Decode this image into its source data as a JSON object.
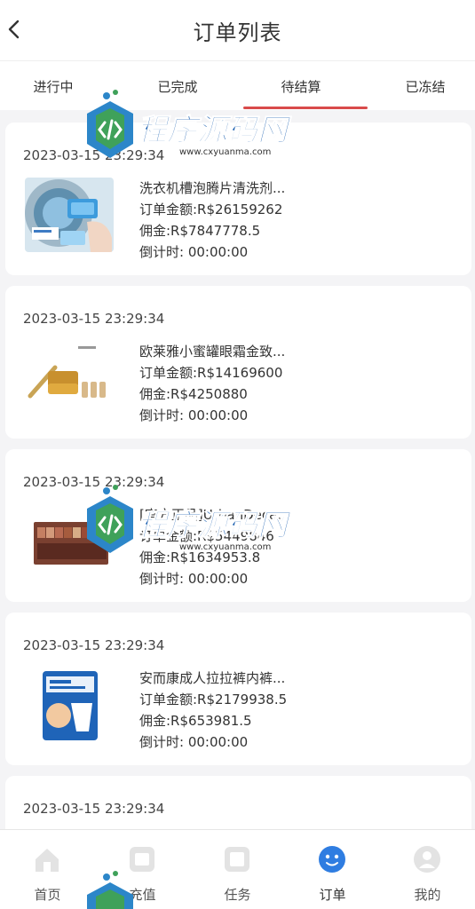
{
  "header": {
    "title": "订单列表"
  },
  "tabs": [
    {
      "label": "进行中",
      "active": false
    },
    {
      "label": "已完成",
      "active": false
    },
    {
      "label": "待结算",
      "active": true
    },
    {
      "label": "已冻结",
      "active": false
    }
  ],
  "orders": [
    {
      "time": "2023-03-15 23:29:34",
      "title": "洗衣机槽泡腾片清洗剂...",
      "amount": "订单金额:R$26159262",
      "commission": "佣金:R$7847778.5",
      "countdown": "倒计时:  00:00:00",
      "image": "laundry-tablets"
    },
    {
      "time": "2023-03-15 23:29:34",
      "title": "欧莱雅小蜜罐眼霜金致...",
      "amount": "订单金额:R$14169600",
      "commission": "佣金:R$4250880",
      "countdown": "倒计时:  00:00:00",
      "image": "eye-cream-set"
    },
    {
      "time": "2023-03-15 23:29:34",
      "title": "[官方正品]UrbanDeca...",
      "amount": "订单金额:R$5449846",
      "commission": "佣金:R$1634953.8",
      "countdown": "倒计时:  00:00:00",
      "image": "eyeshadow-palette"
    },
    {
      "time": "2023-03-15 23:29:34",
      "title": "安而康成人拉拉裤内裤...",
      "amount": "订单金额:R$2179938.5",
      "commission": "佣金:R$653981.5",
      "countdown": "倒计时:  00:00:00",
      "image": "adult-pants-pack"
    },
    {
      "time": "2023-03-15 23:29:34",
      "title": "",
      "amount": "",
      "commission": "",
      "countdown": "",
      "image": "product"
    }
  ],
  "tabbar": [
    {
      "label": "首页",
      "icon": "home-icon"
    },
    {
      "label": "充值",
      "icon": "recharge-icon"
    },
    {
      "label": "任务",
      "icon": "task-icon"
    },
    {
      "label": "订单",
      "icon": "order-icon",
      "active": true
    },
    {
      "label": "我的",
      "icon": "profile-icon"
    }
  ],
  "watermark": {
    "text": "程序源码网",
    "url": "www.cxyuanma.com"
  },
  "colors": {
    "accent": "#d94b4b",
    "active_icon": "#2f7de1",
    "inactive_icon": "#e3e3e3",
    "background": "#f4f4f6"
  }
}
